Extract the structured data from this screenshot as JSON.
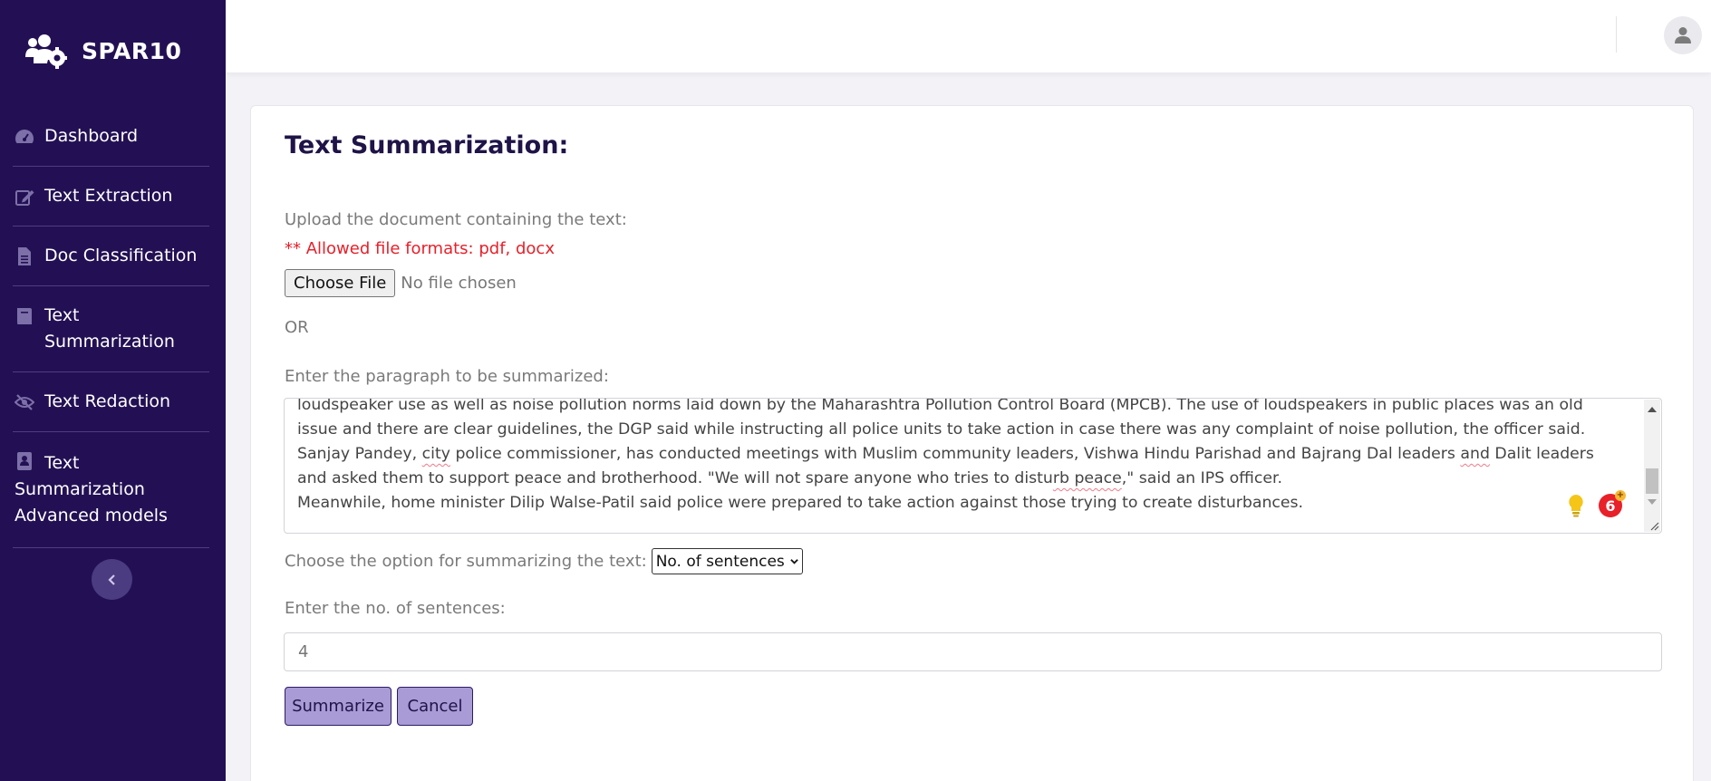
{
  "app": {
    "brand": "SPAR10"
  },
  "sidebar": {
    "items": [
      {
        "label": "Dashboard",
        "icon": "dashboard-icon"
      },
      {
        "label": "Text Extraction",
        "icon": "edit-icon"
      },
      {
        "label": "Doc Classification",
        "icon": "document-icon"
      },
      {
        "label": "Text Summarization",
        "icon": "book-icon"
      },
      {
        "label": "Text Redaction",
        "icon": "eye-slash-icon"
      },
      {
        "label": "Text Summarization Advanced models",
        "icon": "user-document-icon"
      }
    ],
    "collapse_icon": "chevron-left-icon"
  },
  "header": {
    "avatar_icon": "user-icon"
  },
  "main": {
    "title": "Text Summarization:",
    "upload_label": "Upload the document containing the text:",
    "allowed_formats": "** Allowed file formats: pdf, docx",
    "choose_file_label": "Choose File",
    "file_status": "No file chosen",
    "or_text": "OR",
    "paragraph_label": "Enter the paragraph to be summarized:",
    "paragraph_lines": {
      "l1a": "loudspeaker use as well as noise pollution norms laid down by the Maharashtra Pollution Control Board (MPCB). The use of loudspeakers in public places was an old issue and there are clear guidelines, the DGP said while instructing all police units to take action in case there was any complaint of noise pollution, the officer said.",
      "l2a": "Sanjay Pandey, ",
      "l2b": "city",
      "l2c": " police commissioner, has conducted meetings with Muslim community leaders, Vishwa Hindu Parishad and Bajrang Dal leaders ",
      "l2d": "and",
      "l2e": " Dalit leaders and asked them to support peace and brotherhood. \"We will not spare anyone who tries to distu",
      "l2f": "rb peace",
      "l2g": ",\" said an IPS officer.",
      "l3": "Meanwhile, home minister Dilip Walse-Patil said police were prepared to take action against those trying to create disturbances."
    },
    "grammar_badge_count": "6",
    "grammar_badge_plus": "+",
    "option_label": "Choose the option for summarizing the text:",
    "option_selected": "No. of sentences",
    "sentences_label": "Enter the no. of sentences:",
    "sentences_value": "4",
    "summarize_label": "Summarize",
    "cancel_label": "Cancel"
  },
  "colors": {
    "sidebar_bg": "#231054",
    "accent_button": "#a99bd6",
    "warning_text": "#e8202a",
    "title_text": "#1f1347"
  }
}
